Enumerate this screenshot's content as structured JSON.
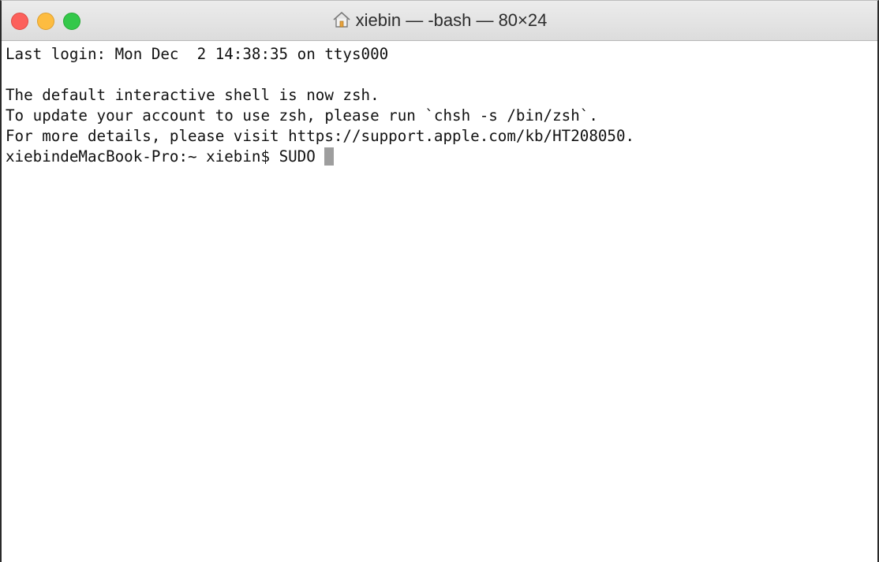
{
  "window": {
    "title": "xiebin — -bash — 80×24",
    "home_icon": "home-icon",
    "traffic_colors": {
      "close": "#fc605b",
      "minimize": "#fdbc40",
      "zoom": "#34c84a"
    }
  },
  "terminal": {
    "lines": [
      "Last login: Mon Dec  2 14:38:35 on ttys000",
      "",
      "The default interactive shell is now zsh.",
      "To update your account to use zsh, please run `chsh -s /bin/zsh`.",
      "For more details, please visit https://support.apple.com/kb/HT208050."
    ],
    "prompt": "xiebindeMacBook-Pro:~ xiebin$ ",
    "input": "SUDO "
  }
}
